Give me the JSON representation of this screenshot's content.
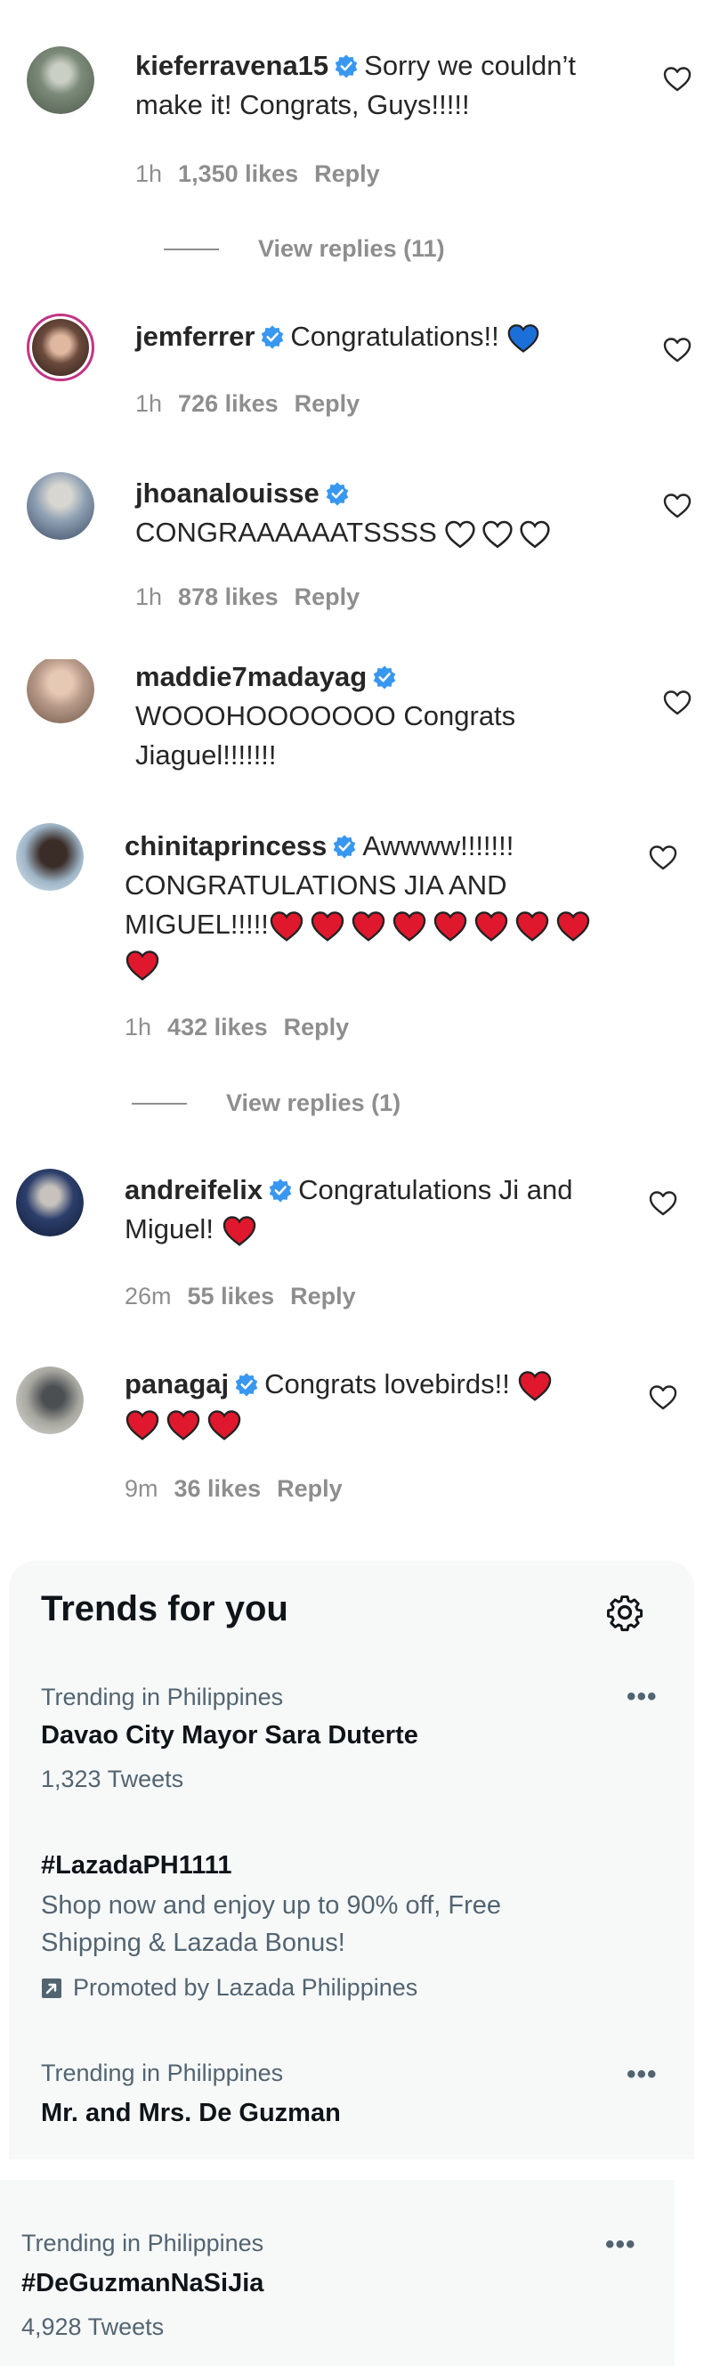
{
  "comments": [
    {
      "username": "kieferravena15",
      "text_lines": [
        "Sorry we couldn’t",
        "make it! Congrats, Guys!!!!!"
      ],
      "time": "1h",
      "likes": "1,350 likes",
      "reply": "Reply",
      "view_replies": "View replies (11)",
      "avatar_color": "#7c8a7a"
    },
    {
      "username": "jemferrer",
      "text_lines": [
        "Congratulations!!"
      ],
      "emoji": "blue-heart",
      "time": "1h",
      "likes": "726 likes",
      "reply": "Reply",
      "avatar_color": "#6b4a3c"
    },
    {
      "username": "jhoanalouisse",
      "text_lines": [
        "CONGRAAAAAATSSSS"
      ],
      "emoji": "white-heart x3",
      "time": "1h",
      "likes": "878 likes",
      "reply": "Reply",
      "avatar_color": "#8fa0b3"
    },
    {
      "username": "maddie7madayag",
      "text_lines": [
        "WOOOHOOOOOOO Congrats",
        "Jiaguel!!!!!!!"
      ],
      "avatar_color": "#b89a8a"
    },
    {
      "username": "chinitaprincess",
      "text_lines": [
        "Awwww!!!!!!!",
        "CONGRATULATIONS JIA AND",
        "MIGUEL!!!!!"
      ],
      "emoji": "red-heart x9",
      "time": "1h",
      "likes": "432 likes",
      "reply": "Reply",
      "view_replies": "View replies (1)",
      "avatar_color": "#9fb6c8"
    },
    {
      "username": "andreifelix",
      "text_lines": [
        "Congratulations Ji and",
        "Miguel!"
      ],
      "emoji": "red-heart",
      "time": "26m",
      "likes": "55 likes",
      "reply": "Reply",
      "avatar_color": "#2c3e6b"
    },
    {
      "username": "panagaj",
      "text_lines": [
        "Congrats lovebirds!!"
      ],
      "emoji": "red-heart x4",
      "time": "9m",
      "likes": "36 likes",
      "reply": "Reply",
      "avatar_color": "#a7a7a0"
    }
  ],
  "trends": {
    "title": "Trends for you",
    "settings_icon": "gear-icon",
    "items": [
      {
        "context": "Trending in Philippines",
        "name": "Davao City Mayor Sara Duterte",
        "count": "1,323 Tweets"
      },
      {
        "name": "#LazadaPH1111",
        "desc_lines": [
          "Shop now and enjoy up to 90% off, Free",
          "Shipping & Lazada Bonus!"
        ],
        "promoted": "Promoted by Lazada Philippines"
      },
      {
        "context": "Trending in Philippines",
        "name": "Mr. and Mrs. De Guzman"
      },
      {
        "context": "Trending in Philippines",
        "name": "#DeGuzmanNaSiJia",
        "count": "4,928 Tweets"
      }
    ],
    "more_glyph": "•••"
  },
  "colors": {
    "verified": "#3897f0",
    "muted": "#8e8e8e",
    "red_heart": "#e0182d",
    "blue_heart": "#1b6fd8",
    "trend_bg": "#f7f9f9"
  }
}
